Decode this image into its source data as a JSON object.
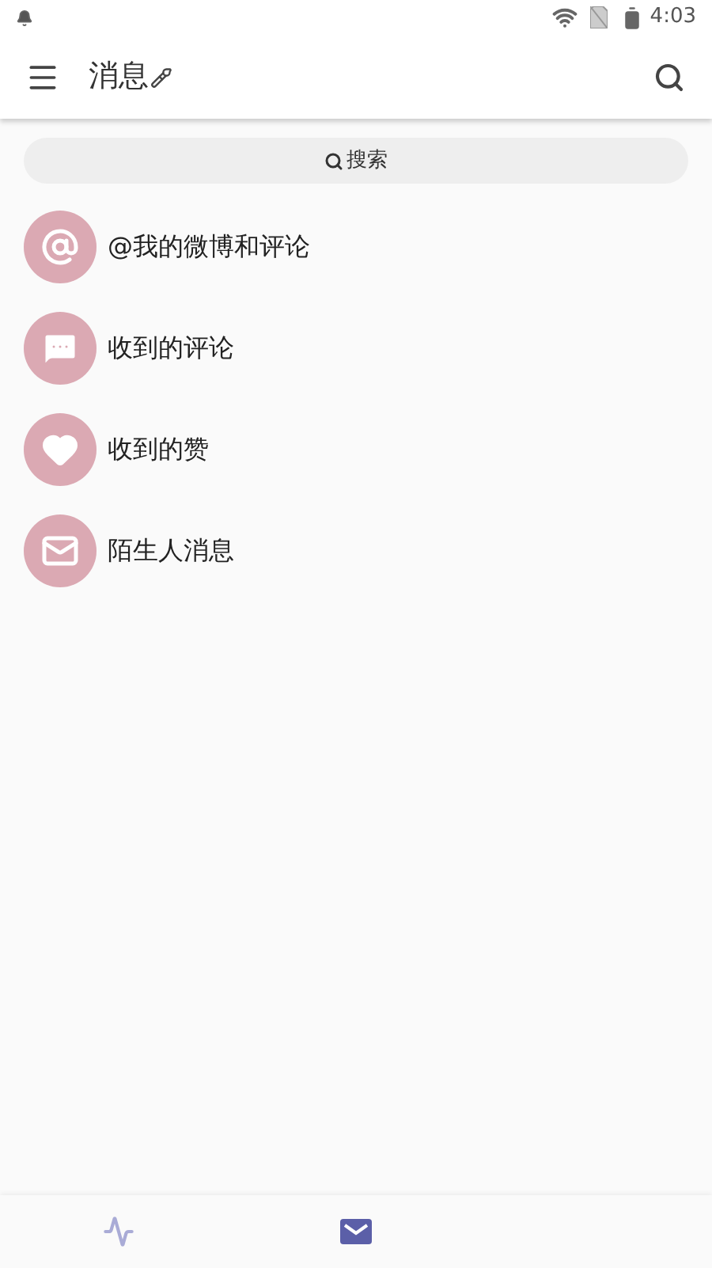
{
  "status_bar": {
    "time": "4:03"
  },
  "app_bar": {
    "title": "消息"
  },
  "search": {
    "placeholder": "搜索"
  },
  "items": [
    {
      "kind": "mention",
      "label": "@我的微博和评论"
    },
    {
      "kind": "comment",
      "label": "收到的评论"
    },
    {
      "kind": "like",
      "label": "收到的赞"
    },
    {
      "kind": "mail",
      "label": "陌生人消息"
    }
  ],
  "bottom_nav": [
    {
      "kind": "trend",
      "selected": false
    },
    {
      "kind": "mail",
      "selected": true
    }
  ]
}
